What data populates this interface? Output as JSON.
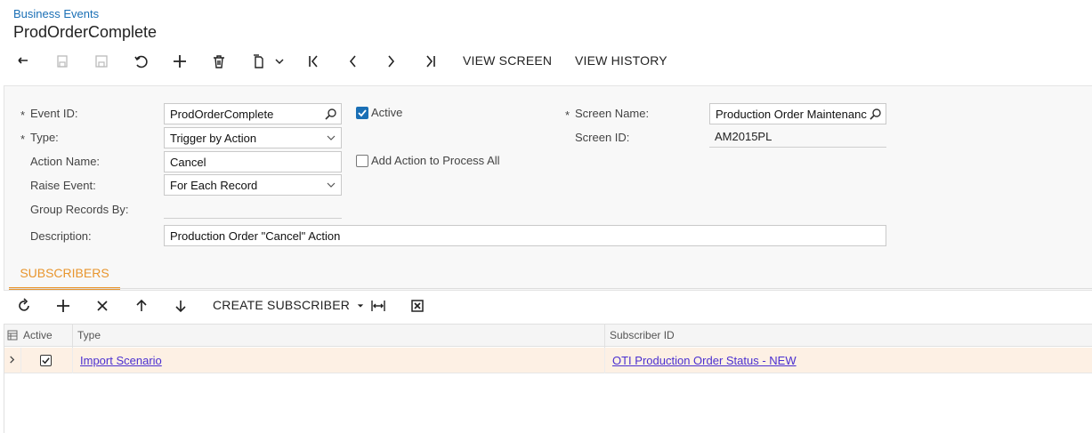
{
  "header": {
    "breadcrumb": "Business Events",
    "title": "ProdOrderComplete"
  },
  "toolbar": {
    "icons": [
      "undo-icon",
      "save-close-icon",
      "save-icon",
      "cancel-icon",
      "add-icon",
      "delete-icon",
      "copy-paste-icon",
      "first-record-icon",
      "previous-record-icon",
      "next-record-icon",
      "last-record-icon"
    ],
    "view_screen_label": "VIEW SCREEN",
    "view_history_label": "VIEW HISTORY"
  },
  "form": {
    "event_id_label": "Event ID:",
    "event_id_value": "ProdOrderComplete",
    "type_label": "Type:",
    "type_value": "Trigger by Action",
    "action_name_label": "Action Name:",
    "action_name_value": "Cancel",
    "raise_event_label": "Raise Event:",
    "raise_event_value": "For Each Record",
    "group_records_label": "Group Records By:",
    "group_records_value": "",
    "description_label": "Description:",
    "description_value": "Production Order \"Cancel\" Action",
    "active_label": "Active",
    "active_checked": true,
    "add_action_label": "Add Action to Process All",
    "add_action_checked": false,
    "screen_name_label": "Screen Name:",
    "screen_name_value": "Production Order Maintenanc",
    "screen_id_label": "Screen ID:",
    "screen_id_value": "AM2015PL",
    "required_marker": "*"
  },
  "tabs": {
    "subscribers_label": "SUBSCRIBERS"
  },
  "grid_toolbar": {
    "create_subscriber_label": "CREATE SUBSCRIBER"
  },
  "grid": {
    "columns": [
      "Active",
      "Type",
      "Subscriber ID"
    ],
    "rows": [
      {
        "active": true,
        "type": "Import Scenario",
        "subscriber_id": "OTI Production Order Status - NEW"
      }
    ]
  },
  "colors": {
    "accent": "#e8952d",
    "link": "#1a6fb5",
    "row_selected": "#fdf0e4"
  }
}
